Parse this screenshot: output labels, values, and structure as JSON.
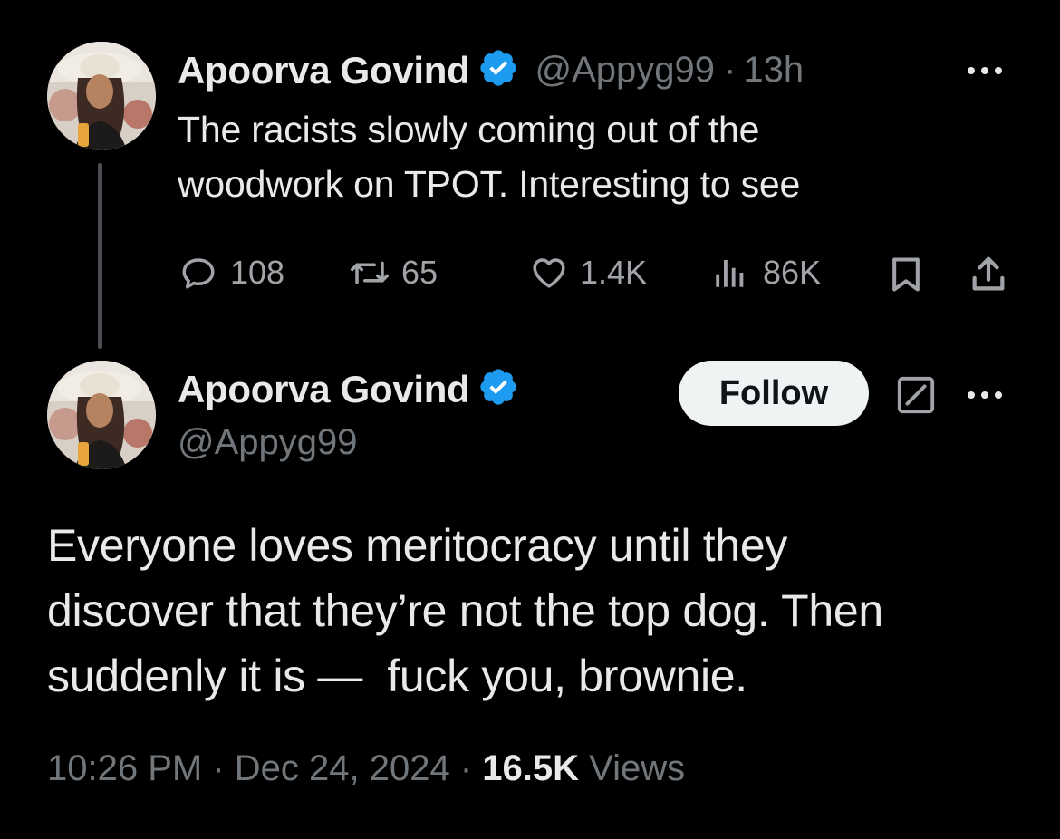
{
  "parent_tweet": {
    "author_name": "Apoorva Govind",
    "handle": "@Appyg99",
    "separator": "·",
    "time_ago": "13h",
    "text_line1": "The racists slowly coming out of the",
    "text_line2": "woodwork on TPOT. Interesting to see",
    "actions": {
      "replies": "108",
      "reposts": "65",
      "likes": "1.4K",
      "views": "86K"
    }
  },
  "main_tweet": {
    "author_name": "Apoorva Govind",
    "handle": "@Appyg99",
    "follow_label": "Follow",
    "text_line1": "Everyone loves meritocracy until they",
    "text_line2": "discover that they’re not the top dog. Then",
    "text_line3": "suddenly it is —  fuck you, brownie.",
    "time": "10:26 PM",
    "sep1": " · ",
    "date": "Dec 24, 2024",
    "sep2": " · ",
    "views_count": "16.5K",
    "views_label": " Views"
  },
  "icons": {
    "verified": "verified-badge-icon",
    "reply": "reply-icon",
    "repost": "repost-icon",
    "like": "heart-icon",
    "views": "views-bar-icon",
    "bookmark": "bookmark-icon",
    "share": "share-icon",
    "more": "more-dots-icon",
    "grok": "grok-icon"
  },
  "colors": {
    "background": "#000000",
    "text": "#e7e9ea",
    "muted": "#71767b",
    "verified_blue": "#1d9bf0",
    "follow_bg": "#eff3f4"
  }
}
